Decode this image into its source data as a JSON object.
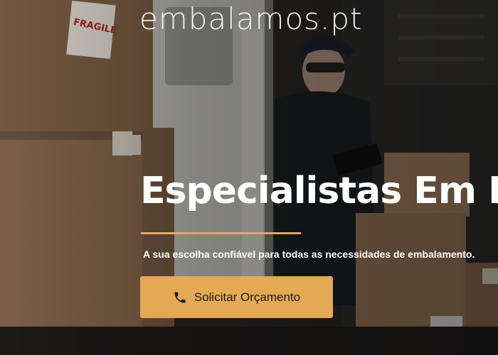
{
  "header": {
    "brand": "embalamos.pt"
  },
  "hero": {
    "headline": "Especialistas Em Embalamento",
    "tagline": "A sua escolha confiável para todas as necessidades de embalamento.",
    "cta_label": "Solicitar Orçamento",
    "cta_icon": "phone-icon",
    "fragile_label_text": "FRAGILE",
    "accent_color": "#e4a954"
  }
}
